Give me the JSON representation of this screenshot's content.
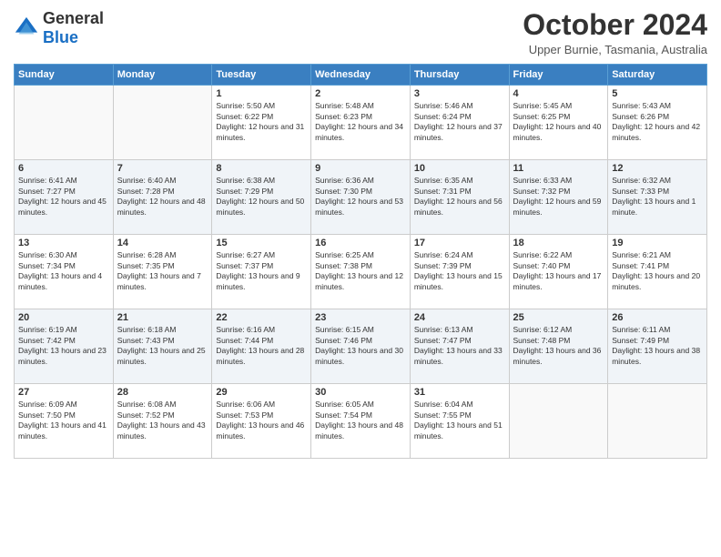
{
  "header": {
    "logo_general": "General",
    "logo_blue": "Blue",
    "month": "October 2024",
    "location": "Upper Burnie, Tasmania, Australia"
  },
  "weekdays": [
    "Sunday",
    "Monday",
    "Tuesday",
    "Wednesday",
    "Thursday",
    "Friday",
    "Saturday"
  ],
  "weeks": [
    [
      {
        "day": "",
        "info": ""
      },
      {
        "day": "",
        "info": ""
      },
      {
        "day": "1",
        "info": "Sunrise: 5:50 AM\nSunset: 6:22 PM\nDaylight: 12 hours and 31 minutes."
      },
      {
        "day": "2",
        "info": "Sunrise: 5:48 AM\nSunset: 6:23 PM\nDaylight: 12 hours and 34 minutes."
      },
      {
        "day": "3",
        "info": "Sunrise: 5:46 AM\nSunset: 6:24 PM\nDaylight: 12 hours and 37 minutes."
      },
      {
        "day": "4",
        "info": "Sunrise: 5:45 AM\nSunset: 6:25 PM\nDaylight: 12 hours and 40 minutes."
      },
      {
        "day": "5",
        "info": "Sunrise: 5:43 AM\nSunset: 6:26 PM\nDaylight: 12 hours and 42 minutes."
      }
    ],
    [
      {
        "day": "6",
        "info": "Sunrise: 6:41 AM\nSunset: 7:27 PM\nDaylight: 12 hours and 45 minutes."
      },
      {
        "day": "7",
        "info": "Sunrise: 6:40 AM\nSunset: 7:28 PM\nDaylight: 12 hours and 48 minutes."
      },
      {
        "day": "8",
        "info": "Sunrise: 6:38 AM\nSunset: 7:29 PM\nDaylight: 12 hours and 50 minutes."
      },
      {
        "day": "9",
        "info": "Sunrise: 6:36 AM\nSunset: 7:30 PM\nDaylight: 12 hours and 53 minutes."
      },
      {
        "day": "10",
        "info": "Sunrise: 6:35 AM\nSunset: 7:31 PM\nDaylight: 12 hours and 56 minutes."
      },
      {
        "day": "11",
        "info": "Sunrise: 6:33 AM\nSunset: 7:32 PM\nDaylight: 12 hours and 59 minutes."
      },
      {
        "day": "12",
        "info": "Sunrise: 6:32 AM\nSunset: 7:33 PM\nDaylight: 13 hours and 1 minute."
      }
    ],
    [
      {
        "day": "13",
        "info": "Sunrise: 6:30 AM\nSunset: 7:34 PM\nDaylight: 13 hours and 4 minutes."
      },
      {
        "day": "14",
        "info": "Sunrise: 6:28 AM\nSunset: 7:35 PM\nDaylight: 13 hours and 7 minutes."
      },
      {
        "day": "15",
        "info": "Sunrise: 6:27 AM\nSunset: 7:37 PM\nDaylight: 13 hours and 9 minutes."
      },
      {
        "day": "16",
        "info": "Sunrise: 6:25 AM\nSunset: 7:38 PM\nDaylight: 13 hours and 12 minutes."
      },
      {
        "day": "17",
        "info": "Sunrise: 6:24 AM\nSunset: 7:39 PM\nDaylight: 13 hours and 15 minutes."
      },
      {
        "day": "18",
        "info": "Sunrise: 6:22 AM\nSunset: 7:40 PM\nDaylight: 13 hours and 17 minutes."
      },
      {
        "day": "19",
        "info": "Sunrise: 6:21 AM\nSunset: 7:41 PM\nDaylight: 13 hours and 20 minutes."
      }
    ],
    [
      {
        "day": "20",
        "info": "Sunrise: 6:19 AM\nSunset: 7:42 PM\nDaylight: 13 hours and 23 minutes."
      },
      {
        "day": "21",
        "info": "Sunrise: 6:18 AM\nSunset: 7:43 PM\nDaylight: 13 hours and 25 minutes."
      },
      {
        "day": "22",
        "info": "Sunrise: 6:16 AM\nSunset: 7:44 PM\nDaylight: 13 hours and 28 minutes."
      },
      {
        "day": "23",
        "info": "Sunrise: 6:15 AM\nSunset: 7:46 PM\nDaylight: 13 hours and 30 minutes."
      },
      {
        "day": "24",
        "info": "Sunrise: 6:13 AM\nSunset: 7:47 PM\nDaylight: 13 hours and 33 minutes."
      },
      {
        "day": "25",
        "info": "Sunrise: 6:12 AM\nSunset: 7:48 PM\nDaylight: 13 hours and 36 minutes."
      },
      {
        "day": "26",
        "info": "Sunrise: 6:11 AM\nSunset: 7:49 PM\nDaylight: 13 hours and 38 minutes."
      }
    ],
    [
      {
        "day": "27",
        "info": "Sunrise: 6:09 AM\nSunset: 7:50 PM\nDaylight: 13 hours and 41 minutes."
      },
      {
        "day": "28",
        "info": "Sunrise: 6:08 AM\nSunset: 7:52 PM\nDaylight: 13 hours and 43 minutes."
      },
      {
        "day": "29",
        "info": "Sunrise: 6:06 AM\nSunset: 7:53 PM\nDaylight: 13 hours and 46 minutes."
      },
      {
        "day": "30",
        "info": "Sunrise: 6:05 AM\nSunset: 7:54 PM\nDaylight: 13 hours and 48 minutes."
      },
      {
        "day": "31",
        "info": "Sunrise: 6:04 AM\nSunset: 7:55 PM\nDaylight: 13 hours and 51 minutes."
      },
      {
        "day": "",
        "info": ""
      },
      {
        "day": "",
        "info": ""
      }
    ]
  ]
}
